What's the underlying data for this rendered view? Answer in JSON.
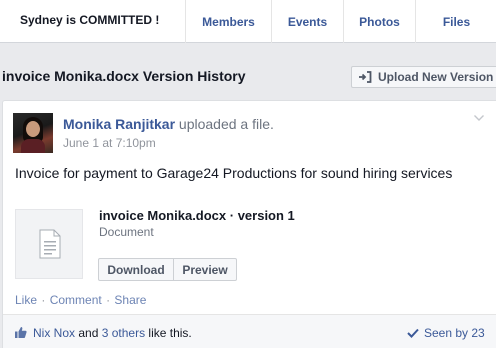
{
  "header": {
    "group_name": "Sydney is COMMITTED !",
    "tabs": [
      {
        "label": "Members"
      },
      {
        "label": "Events"
      },
      {
        "label": "Photos"
      },
      {
        "label": "Files"
      }
    ]
  },
  "page": {
    "title": "invoice Monika.docx Version History",
    "upload_button": "Upload New Version"
  },
  "post": {
    "author": "Monika Ranjitkar",
    "action": "uploaded a file.",
    "time": "June 1 at 7:10pm",
    "text": "Invoice for payment to Garage24 Productions for sound hiring services",
    "file": {
      "title": "invoice Monika.docx · version 1",
      "type": "Document",
      "download_label": "Download",
      "preview_label": "Preview"
    },
    "actions": {
      "like": "Like",
      "comment": "Comment",
      "share": "Share",
      "separator": "·"
    },
    "likes": {
      "first_name": "Nix Nox",
      "and": " and ",
      "others": "3 others",
      "suffix": " like this."
    },
    "seen_by": "Seen by 23"
  },
  "icons": {
    "upload": "upload-icon",
    "chevron": "chevron-down-icon",
    "document": "document-icon",
    "like": "thumbs-up-icon",
    "seen": "checkmark-icon"
  },
  "colors": {
    "link": "#3b5998",
    "background": "#e9eaed",
    "card": "#ffffff"
  }
}
